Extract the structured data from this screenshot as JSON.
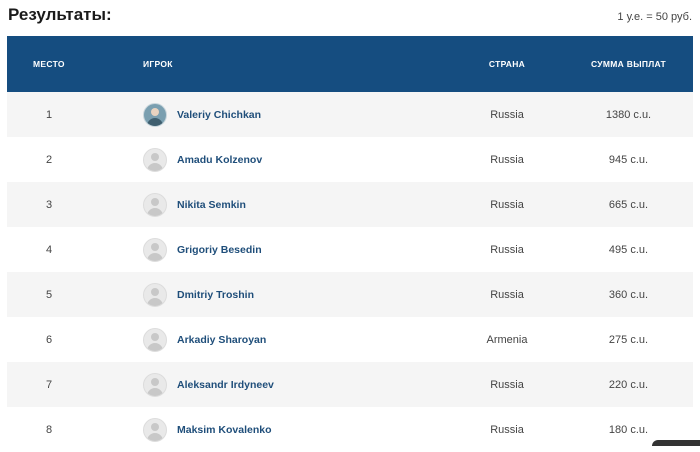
{
  "page": {
    "title": "Результаты:",
    "rate_note": "1 у.е. = 50 руб."
  },
  "table": {
    "headers": {
      "place": "МЕСТО",
      "player": "ИГРОК",
      "country": "СТРАНА",
      "sum": "СУММА ВЫПЛАТ"
    },
    "rows": [
      {
        "place": "1",
        "player": "Valeriy Chichkan",
        "country": "Russia",
        "sum": "1380 c.u.",
        "avatar": "photo-avatar"
      },
      {
        "place": "2",
        "player": "Amadu Kolzenov",
        "country": "Russia",
        "sum": "945 c.u.",
        "avatar": "placeholder-avatar"
      },
      {
        "place": "3",
        "player": "Nikita Semkin",
        "country": "Russia",
        "sum": "665 c.u.",
        "avatar": "placeholder-avatar"
      },
      {
        "place": "4",
        "player": "Grigoriy Besedin",
        "country": "Russia",
        "sum": "495 c.u.",
        "avatar": "placeholder-avatar"
      },
      {
        "place": "5",
        "player": "Dmitriy Troshin",
        "country": "Russia",
        "sum": "360 c.u.",
        "avatar": "placeholder-avatar"
      },
      {
        "place": "6",
        "player": "Arkadiy Sharoyan",
        "country": "Armenia",
        "sum": "275 c.u.",
        "avatar": "placeholder-avatar"
      },
      {
        "place": "7",
        "player": "Aleksandr Irdyneev",
        "country": "Russia",
        "sum": "220 c.u.",
        "avatar": "placeholder-avatar"
      },
      {
        "place": "8",
        "player": "Maksim Kovalenko",
        "country": "Russia",
        "sum": "180 c.u.",
        "avatar": "placeholder-avatar"
      }
    ]
  },
  "colors": {
    "header_bg": "#154d80",
    "link": "#1f4e7a",
    "row_alt": "#f5f5f5"
  }
}
